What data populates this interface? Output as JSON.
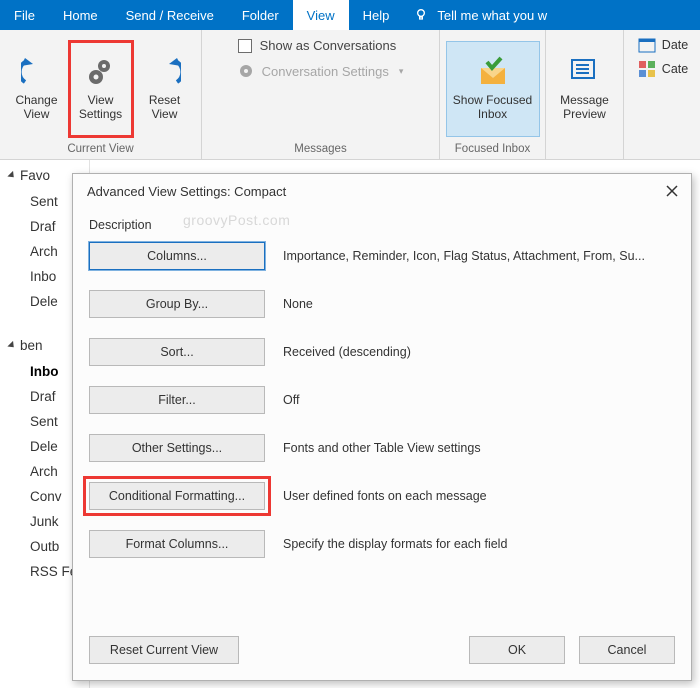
{
  "menubar": {
    "items": [
      "File",
      "Home",
      "Send / Receive",
      "Folder",
      "View",
      "Help"
    ],
    "active_index": 4,
    "tell_me": "Tell me what you w"
  },
  "ribbon": {
    "current_view": {
      "label": "Current View",
      "change_view": "Change\nView",
      "view_settings": "View\nSettings",
      "reset_view": "Reset\nView"
    },
    "messages": {
      "label": "Messages",
      "show_conversations": "Show as Conversations",
      "conversation_settings": "Conversation Settings"
    },
    "focused_inbox": {
      "label": "Focused Inbox",
      "show_focused": "Show Focused\nInbox"
    },
    "message_preview": "Message\nPreview",
    "right_extras": {
      "date": "Date",
      "cate": "Cate"
    }
  },
  "nav": {
    "favorites": {
      "title": "Favo",
      "items": [
        "Sent",
        "Draf",
        "Arch",
        "Inbo",
        "Dele"
      ]
    },
    "account": {
      "title": "ben",
      "items": [
        "Inbo",
        "Draf",
        "Sent",
        "Dele",
        "Arch",
        "Conv",
        "Junk",
        "Outb",
        "RSS Feeds"
      ],
      "selected_index": 0
    }
  },
  "dialog": {
    "title": "Advanced View Settings: Compact",
    "description_label": "Description",
    "watermark": "groovyPost.com",
    "rows": [
      {
        "button": "Columns...",
        "value": "Importance, Reminder, Icon, Flag Status, Attachment, From, Su..."
      },
      {
        "button": "Group By...",
        "value": "None"
      },
      {
        "button": "Sort...",
        "value": "Received (descending)"
      },
      {
        "button": "Filter...",
        "value": "Off"
      },
      {
        "button": "Other Settings...",
        "value": "Fonts and other Table View settings"
      },
      {
        "button": "Conditional Formatting...",
        "value": "User defined fonts on each message"
      },
      {
        "button": "Format Columns...",
        "value": "Specify the display formats for each field"
      }
    ],
    "reset": "Reset Current View",
    "ok": "OK",
    "cancel": "Cancel"
  }
}
